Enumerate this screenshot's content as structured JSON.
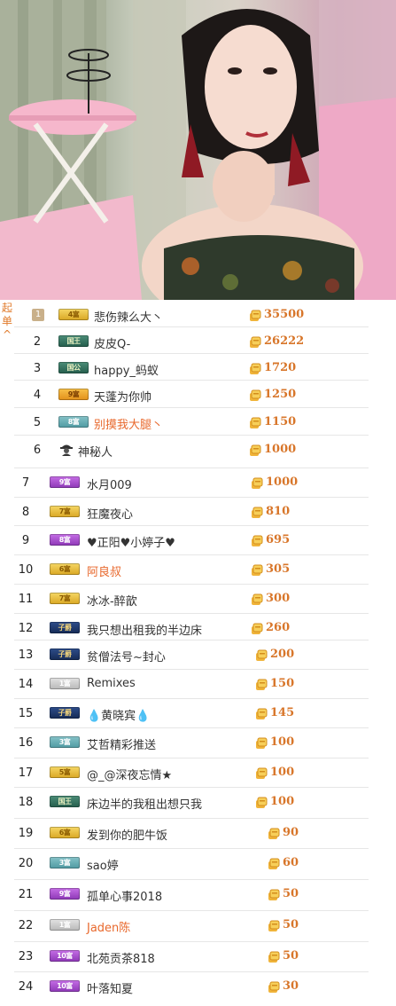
{
  "stream": {
    "scene": "live-stream-video-frame"
  },
  "side_tab": {
    "chars": [
      "起",
      "单",
      "^"
    ]
  },
  "colors": {
    "amount": "#d8762a",
    "highlight_name": "#e8682c",
    "rank_one_bg": "#c9b08a"
  },
  "rankings": [
    {
      "rank": "1",
      "badge": "4富",
      "badge_style": "gold",
      "name": "悲伤辣么大丶",
      "amount": "35500",
      "highlight": false
    },
    {
      "rank": "2",
      "badge": "国王",
      "badge_style": "green",
      "name": "皮皮Q-",
      "amount": "26222",
      "highlight": false
    },
    {
      "rank": "3",
      "badge": "国公",
      "badge_style": "green",
      "name": "happy_蚂蚁",
      "amount": "1720",
      "highlight": false
    },
    {
      "rank": "4",
      "badge": "9富",
      "badge_style": "orange",
      "name": "天蓬为你帅",
      "amount": "1250",
      "highlight": false
    },
    {
      "rank": "5",
      "badge": "8富",
      "badge_style": "teal",
      "name": "别摸我大腿丶",
      "amount": "1150",
      "highlight": true
    },
    {
      "rank": "6",
      "badge": "",
      "badge_style": "mystery",
      "name": "神秘人",
      "amount": "1000",
      "highlight": false
    },
    {
      "rank": "7",
      "badge": "9富",
      "badge_style": "purple",
      "name": "水月009",
      "amount": "1000",
      "highlight": false
    },
    {
      "rank": "8",
      "badge": "7富",
      "badge_style": "gold",
      "name": "狂魔夜心",
      "amount": "810",
      "highlight": false
    },
    {
      "rank": "9",
      "badge": "8富",
      "badge_style": "purple",
      "name": "♥正阳♥小婷子♥",
      "amount": "695",
      "highlight": false
    },
    {
      "rank": "10",
      "badge": "6富",
      "badge_style": "gold",
      "name": "阿良叔",
      "amount": "305",
      "highlight": true
    },
    {
      "rank": "11",
      "badge": "7富",
      "badge_style": "gold",
      "name": "冰冰-醉歆",
      "amount": "300",
      "highlight": false
    },
    {
      "rank": "12",
      "badge": "子爵",
      "badge_style": "navy",
      "name": "我只想出租我的半边床",
      "amount": "260",
      "highlight": false
    },
    {
      "rank": "13",
      "badge": "子爵",
      "badge_style": "navy",
      "name": "贫僧法号~封心",
      "amount": "200",
      "highlight": false
    },
    {
      "rank": "14",
      "badge": "1富",
      "badge_style": "gray",
      "name": "Remixes",
      "amount": "150",
      "highlight": false
    },
    {
      "rank": "15",
      "badge": "子爵",
      "badge_style": "navy",
      "name": "💧黄晓宾💧",
      "amount": "145",
      "highlight": false
    },
    {
      "rank": "16",
      "badge": "3富",
      "badge_style": "teal",
      "name": "艾哲精彩推送",
      "amount": "100",
      "highlight": false
    },
    {
      "rank": "17",
      "badge": "5富",
      "badge_style": "gold",
      "name": "@_@深夜忘情★",
      "amount": "100",
      "highlight": false
    },
    {
      "rank": "18",
      "badge": "国王",
      "badge_style": "green",
      "name": "床边半的我租出想只我",
      "amount": "100",
      "highlight": false
    },
    {
      "rank": "19",
      "badge": "6富",
      "badge_style": "gold",
      "name": "发到你的肥牛饭",
      "amount": "90",
      "highlight": false
    },
    {
      "rank": "20",
      "badge": "3富",
      "badge_style": "teal",
      "name": "sao婷",
      "amount": "60",
      "highlight": false
    },
    {
      "rank": "21",
      "badge": "9富",
      "badge_style": "purple",
      "name": "孤单心事2018",
      "amount": "50",
      "highlight": false
    },
    {
      "rank": "22",
      "badge": "1富",
      "badge_style": "gray",
      "name": "Jaden陈",
      "amount": "50",
      "highlight": true
    },
    {
      "rank": "23",
      "badge": "10富",
      "badge_style": "purple",
      "name": "北苑贡茶818",
      "amount": "50",
      "highlight": false
    },
    {
      "rank": "24",
      "badge": "10富",
      "badge_style": "purple",
      "name": "叶落知夏",
      "amount": "30",
      "highlight": false
    }
  ]
}
